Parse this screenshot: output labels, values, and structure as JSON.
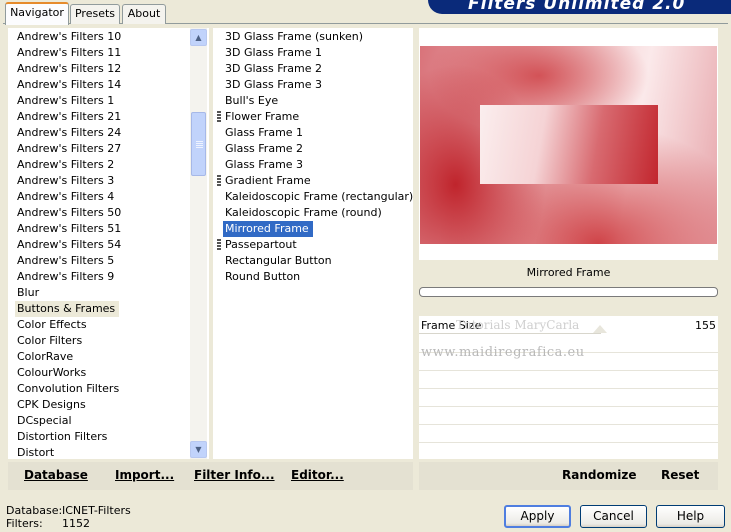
{
  "tabs": [
    {
      "label": "Navigator",
      "active": true
    },
    {
      "label": "Presets",
      "active": false
    },
    {
      "label": "About",
      "active": false
    }
  ],
  "banner_title": "Filters Unlimited 2.0",
  "categories": [
    "Andrew's Filters 10",
    "Andrew's Filters 11",
    "Andrew's Filters 12",
    "Andrew's Filters 14",
    "Andrew's Filters 1",
    "Andrew's Filters 21",
    "Andrew's Filters 24",
    "Andrew's Filters 27",
    "Andrew's Filters 2",
    "Andrew's Filters 3",
    "Andrew's Filters 4",
    "Andrew's Filters 50",
    "Andrew's Filters 51",
    "Andrew's Filters 54",
    "Andrew's Filters 5",
    "Andrew's Filters 9",
    "Blur",
    "Buttons & Frames",
    "Color Effects",
    "Color Filters",
    "ColorRave",
    "ColourWorks",
    "Convolution Filters",
    "CPK Designs",
    "DCspecial",
    "Distortion Filters",
    "Distort"
  ],
  "selected_category": "Buttons & Frames",
  "filters": [
    {
      "label": "3D Glass Frame (sunken)",
      "marker": false
    },
    {
      "label": "3D Glass Frame 1",
      "marker": false
    },
    {
      "label": "3D Glass Frame 2",
      "marker": false
    },
    {
      "label": "3D Glass Frame 3",
      "marker": false
    },
    {
      "label": "Bull's Eye",
      "marker": false
    },
    {
      "label": "Flower Frame",
      "marker": true
    },
    {
      "label": "Glass Frame 1",
      "marker": false
    },
    {
      "label": "Glass Frame 2",
      "marker": false
    },
    {
      "label": "Glass Frame 3",
      "marker": false
    },
    {
      "label": "Gradient Frame",
      "marker": true
    },
    {
      "label": "Kaleidoscopic Frame (rectangular)",
      "marker": false
    },
    {
      "label": "Kaleidoscopic Frame (round)",
      "marker": false
    },
    {
      "label": "Mirrored Frame",
      "marker": false
    },
    {
      "label": "Passepartout",
      "marker": true
    },
    {
      "label": "Rectangular Button",
      "marker": false
    },
    {
      "label": "Round Button",
      "marker": false
    }
  ],
  "selected_filter": "Mirrored Frame",
  "preview": {
    "filter_name": "Mirrored Frame",
    "accent": "#c0232b"
  },
  "params": {
    "frame_size_label": "Frame Size",
    "frame_size_value": "155",
    "frame_size_level": 0.61
  },
  "watermark": {
    "line1": "Tutorials MaryCarla",
    "line2": "www.maidiregrafica.eu"
  },
  "bottom_buttons": {
    "database": "Database",
    "import": "Import...",
    "filter_info": "Filter Info...",
    "editor": "Editor...",
    "randomize": "Randomize",
    "reset": "Reset"
  },
  "status": {
    "database_label": "Database:",
    "database_value": "ICNET-Filters",
    "filters_label": "Filters:",
    "filters_value": "1152"
  },
  "dialog_buttons": {
    "apply": "Apply",
    "cancel": "Cancel",
    "help": "Help"
  }
}
